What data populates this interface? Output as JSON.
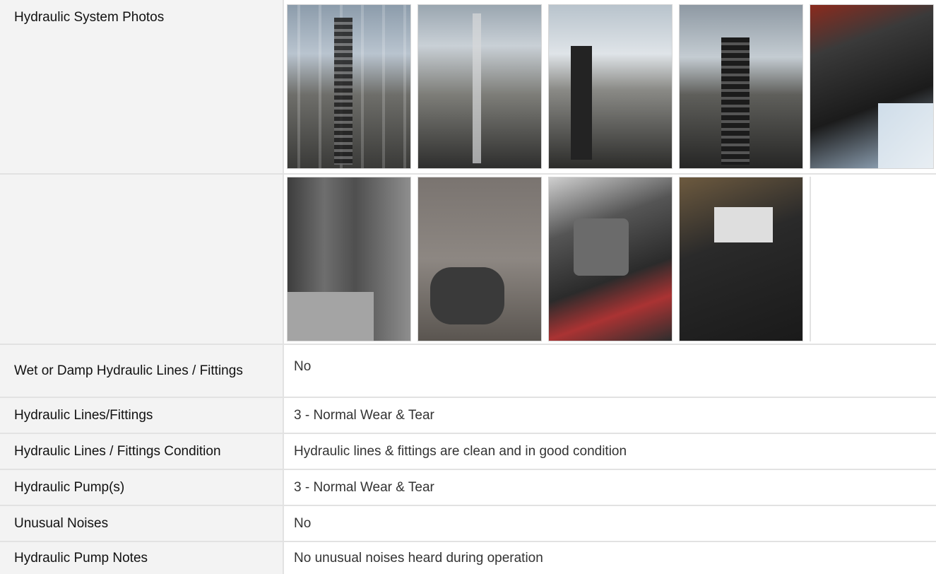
{
  "photos_section": {
    "label": "Hydraulic System Photos",
    "row1": [
      {
        "icon": "photo-mast-chain-1"
      },
      {
        "icon": "photo-mast-chain-2"
      },
      {
        "icon": "photo-mast-chain-3"
      },
      {
        "icon": "photo-mast-chain-4"
      },
      {
        "icon": "photo-lift-carriage"
      }
    ],
    "row2": [
      {
        "icon": "photo-frame-panel-1"
      },
      {
        "icon": "photo-frame-panel-2"
      },
      {
        "icon": "photo-hydraulic-pump"
      },
      {
        "icon": "photo-pump-motor"
      }
    ]
  },
  "rows": [
    {
      "label": "Wet or Damp Hydraulic Lines / Fittings",
      "value": "No"
    },
    {
      "label": "Hydraulic Lines/Fittings",
      "value": "3 - Normal Wear & Tear"
    },
    {
      "label": "Hydraulic Lines / Fittings Condition",
      "value": "Hydraulic lines & fittings are clean and in good condition"
    },
    {
      "label": "Hydraulic Pump(s)",
      "value": "3 - Normal Wear & Tear"
    },
    {
      "label": "Unusual Noises",
      "value": "No"
    },
    {
      "label": "Hydraulic Pump Notes",
      "value": "No unusual noises heard during operation"
    }
  ]
}
